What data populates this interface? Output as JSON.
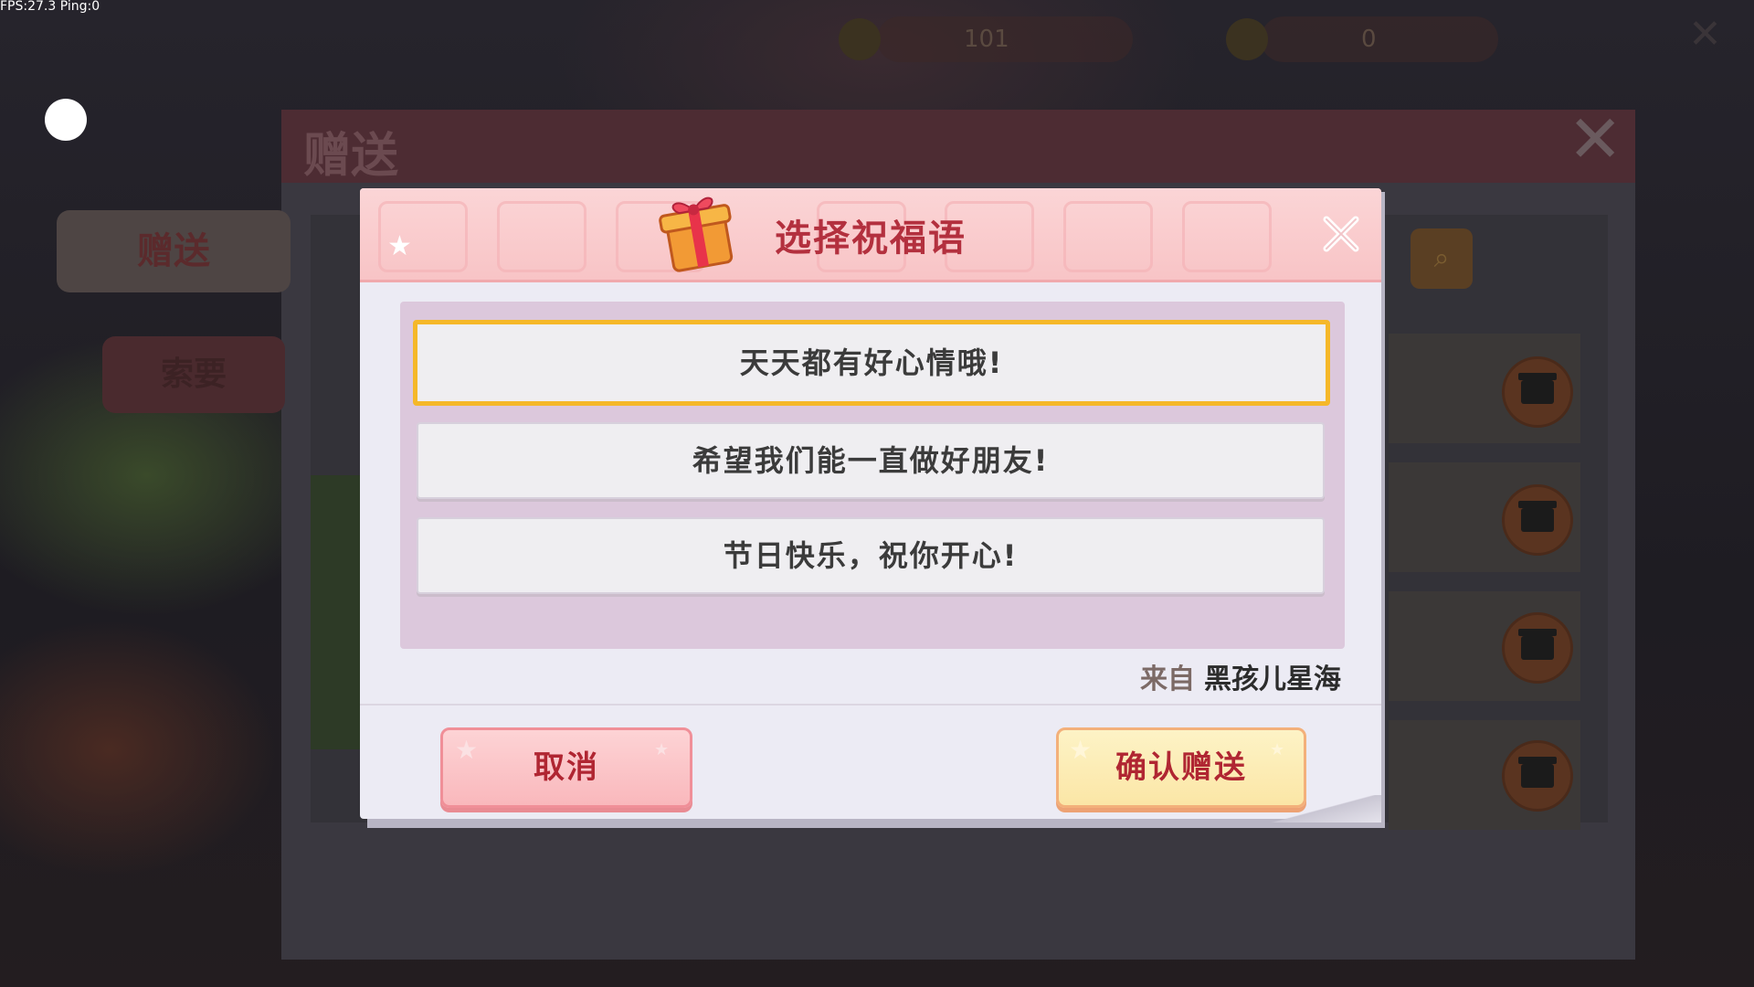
{
  "hud": {
    "fps_text": "FPS:27.3  Ping:0",
    "top_value_1": "101",
    "top_value_2": "0"
  },
  "background_panel": {
    "title": "赠送",
    "tabs": [
      {
        "label": "赠送",
        "active": true
      },
      {
        "label": "索要",
        "active": false
      }
    ]
  },
  "dialog": {
    "title": "选择祝福语",
    "options": [
      {
        "text": "天天都有好心情哦!",
        "selected": true
      },
      {
        "text": "希望我们能一直做好朋友!",
        "selected": false
      },
      {
        "text": "节日快乐，祝你开心!",
        "selected": false
      }
    ],
    "from_label": "来自",
    "from_name": "黑孩儿星海",
    "cancel_label": "取消",
    "confirm_label": "确认赠送"
  },
  "colors": {
    "title_red": "#b3303e",
    "selected_border": "#f5b829",
    "header_pink": "#f8c4c6",
    "options_bg": "#dcc8dc"
  },
  "icons": [
    "gift-icon",
    "close-icon",
    "search-icon",
    "gift-box-icon"
  ]
}
